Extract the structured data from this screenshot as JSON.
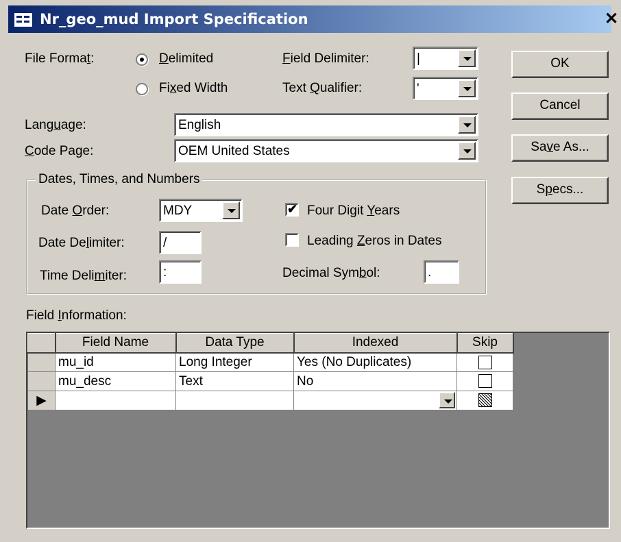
{
  "window": {
    "title": "Nr_geo_mud Import Specification",
    "close_glyph": "✕"
  },
  "file_format": {
    "label": "File Format:",
    "options": [
      {
        "label": "Delimited",
        "selected": true
      },
      {
        "label": "Fixed Width",
        "selected": false
      }
    ]
  },
  "field_delimiter": {
    "label": "Field Delimiter:",
    "value": "|"
  },
  "text_qualifier": {
    "label": "Text Qualifier:",
    "value": "'"
  },
  "language": {
    "label": "Language:",
    "value": "English"
  },
  "code_page": {
    "label": "Code Page:",
    "value": "OEM United States"
  },
  "dates_group": {
    "title": "Dates, Times, and Numbers",
    "date_order": {
      "label": "Date Order:",
      "value": "MDY"
    },
    "date_delimiter": {
      "label": "Date Delimiter:",
      "value": "/"
    },
    "time_delimiter": {
      "label": "Time Delimiter:",
      "value": ":"
    },
    "four_digit_years": {
      "label": "Four Digit Years",
      "checked": true
    },
    "leading_zeros": {
      "label": "Leading Zeros in Dates",
      "checked": false
    },
    "decimal_symbol": {
      "label": "Decimal Symbol:",
      "value": "."
    }
  },
  "buttons": {
    "ok": "OK",
    "cancel": "Cancel",
    "save_as": "Save As...",
    "specs": "Specs..."
  },
  "field_info": {
    "label": "Field Information:",
    "columns": [
      "Field Name",
      "Data Type",
      "Indexed",
      "Skip"
    ],
    "rows": [
      {
        "field_name": "mu_id",
        "data_type": "Long Integer",
        "indexed": "Yes (No Duplicates)",
        "skip": false
      },
      {
        "field_name": "mu_desc",
        "data_type": "Text",
        "indexed": "No",
        "skip": false
      }
    ],
    "current_row_glyph": "▶"
  }
}
